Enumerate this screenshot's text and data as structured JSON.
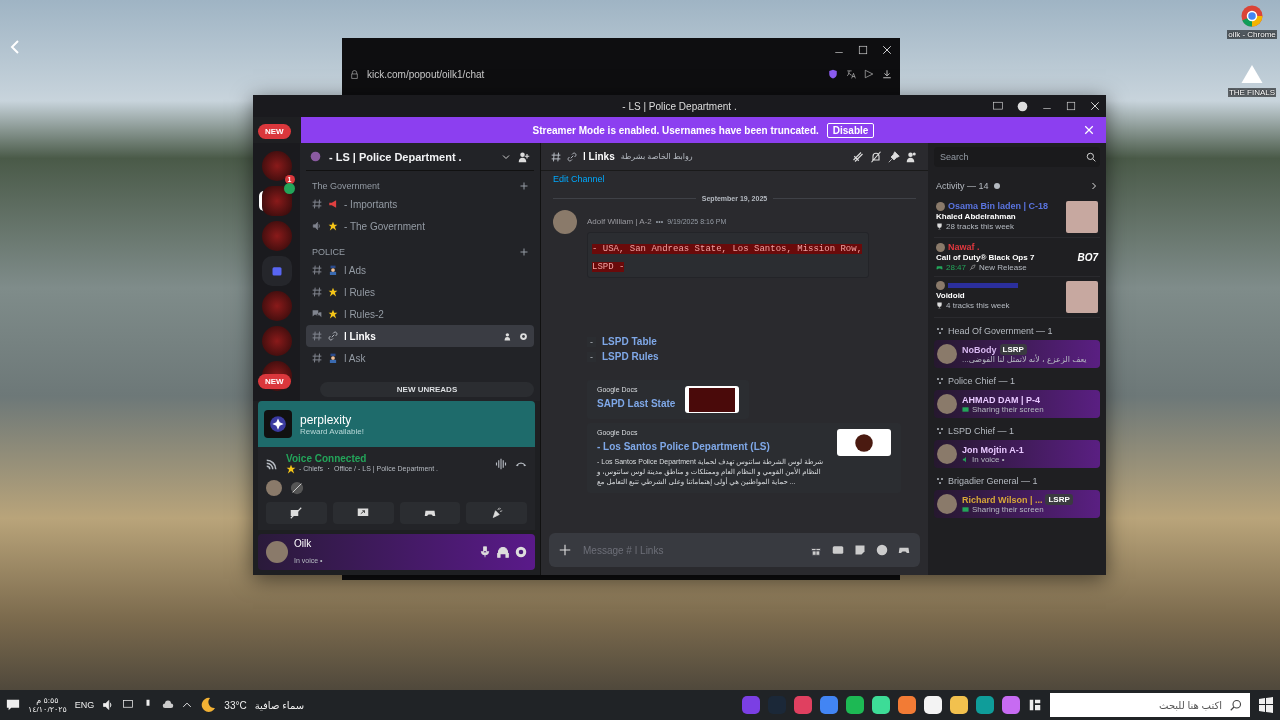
{
  "desktop": {
    "icons": [
      {
        "label": "oilk - Chrome",
        "kind": "chrome"
      },
      {
        "label": "THE FINALS",
        "kind": "finals"
      }
    ]
  },
  "browser": {
    "url": "kick.com/popout/oilk1/chat"
  },
  "discord": {
    "title": "- LS | Police Department .",
    "banner": {
      "text": "Streamer Mode is enabled. Usernames have been truncated.",
      "button": "Disable"
    },
    "new_pills": [
      "NEW",
      "NEW"
    ],
    "servers": [
      {
        "kind": "avatar",
        "badge": "1",
        "selected": false
      },
      {
        "kind": "avatar",
        "voice": true,
        "selected": true
      },
      {
        "kind": "avatar",
        "selected": false
      },
      {
        "kind": "folder",
        "selected": false
      },
      {
        "kind": "avatar",
        "selected": false
      },
      {
        "kind": "avatar",
        "selected": false
      },
      {
        "kind": "avatar",
        "selected": false
      }
    ],
    "server_name": "- LS | Police Department .",
    "channel_groups": [
      {
        "name": "The Government",
        "channels": [
          {
            "kind": "text",
            "emoji": {
              "kind": "megaphone"
            },
            "name": "- Importants",
            "selected": false
          },
          {
            "kind": "voice",
            "emoji": {
              "kind": "star"
            },
            "name": "- The Government",
            "selected": false
          }
        ]
      },
      {
        "name": "POLICE",
        "channels": [
          {
            "kind": "text",
            "emoji": {
              "kind": "officer"
            },
            "name": "ǀ Ads",
            "selected": false
          },
          {
            "kind": "text",
            "emoji": {
              "kind": "star"
            },
            "name": "ǀ Rules",
            "selected": false
          },
          {
            "kind": "forum",
            "emoji": {
              "kind": "star"
            },
            "name": "ǀ Rules-2",
            "selected": false
          },
          {
            "kind": "text",
            "emoji": {
              "kind": "link"
            },
            "name": "ǀ Links",
            "selected": true
          },
          {
            "kind": "text",
            "emoji": {
              "kind": "officer"
            },
            "name": "ǀ Ask",
            "selected": false
          }
        ]
      }
    ],
    "new_unreads": "NEW UNREADS",
    "promo": {
      "title": "perplexity",
      "subtitle": "Reward Available!"
    },
    "voice": {
      "status": "Voice Connected",
      "location": "- Chiefs ・ Office / - LS | Police Department ."
    },
    "user": {
      "name": "Oilk",
      "status": "In voice •"
    },
    "chat": {
      "channel": "ǀ Links",
      "topic": "روابط الخاصة بشرطة",
      "edit_channel": "Edit Channel",
      "date": "September 19, 2025",
      "message": {
        "author": "Adolf William | A-2",
        "dots": "•••",
        "time": "9/19/2025 8:16 PM",
        "code": "- USA, San Andreas State, Los Santos, Mission Row, LSPD -",
        "links": [
          {
            "dash": "-",
            "text": "LSPD Table"
          },
          {
            "dash": "-",
            "text": "LSPD Rules"
          }
        ],
        "embeds": [
          {
            "provider": "Google Docs",
            "title": "SAPD Last State",
            "kind": "small"
          },
          {
            "provider": "Google Docs",
            "title": "- Los Santos Police Department (LS)",
            "kind": "large",
            "description": "- Los Santos Police Department شرطة لوس الشرطة ساتنوس تهدف لحماية النظام الأمن القومي و النظام العام وممتلكات و مناطق مدينة لوس سانتوس، و حماية المواطنين هي أولى إهتماماتنا وعلى الشرطي تتبع التعامل مع ..."
          }
        ]
      },
      "input_placeholder": "Message # ǀ Links"
    },
    "search_placeholder": "Search",
    "activity": {
      "title": "Activity — 14",
      "items": [
        {
          "user": "Osama Bin laden | C-18",
          "color": "#5a74e0",
          "title": "Khaled Abdelrahman",
          "detail": "28 tracks this week",
          "kind": "music"
        },
        {
          "user": "Nawaf .",
          "color": "#e0383f",
          "title": "Call of Duty® Black Ops 7",
          "time": "28:47",
          "detail": "New Release",
          "kind": "game",
          "art": "BO7"
        },
        {
          "title": "Voidoid",
          "color": "#2b2f9c",
          "detail": "4 tracks this week",
          "kind": "music"
        }
      ]
    },
    "roles": [
      {
        "name": "Head Of Government — 1",
        "members": [
          {
            "name": "NoBody",
            "color": "#d8b8f0",
            "tag": "LSRP",
            "status": "...يعف الزعزع ، لأنه لاتمثل لنا الفوضى",
            "kind": "custom"
          }
        ]
      },
      {
        "name": "Police Chief — 1",
        "members": [
          {
            "name": "AHMAD DAM | P-4",
            "color": "#e8c8ff",
            "status": "Sharing their screen",
            "kind": "screen"
          }
        ]
      },
      {
        "name": "LSPD Chief — 1",
        "members": [
          {
            "name": "Jon Mojtin A-1",
            "color": "#e8c8ff",
            "status": "In voice •",
            "kind": "voice"
          }
        ]
      },
      {
        "name": "Brigadier General — 1",
        "members": [
          {
            "name": "Richard Wilson | ...",
            "color": "#d8a838",
            "tag": "LSRP",
            "status": "Sharing their screen",
            "kind": "screen"
          }
        ]
      }
    ]
  },
  "taskbar": {
    "time": "٥:٥٥ م",
    "date": "١٤/١٠/٢٠٢٥",
    "language": "ENG",
    "temperature": "33°C",
    "weather": "سماء صافية",
    "search_placeholder": "اكتب هنا للبحث",
    "apps": [
      {
        "color": "#7b3fe4"
      },
      {
        "color": "#1b2838"
      },
      {
        "color": "#e04060"
      },
      {
        "color": "#4285f4"
      },
      {
        "color": "#1db954"
      },
      {
        "color": "#3ddc97"
      },
      {
        "color": "#f27b35"
      },
      {
        "color": "#f3f3f3"
      },
      {
        "color": "#f2c14e"
      },
      {
        "color": "#0f9d9a"
      },
      {
        "color": "#c76bf2"
      }
    ]
  }
}
